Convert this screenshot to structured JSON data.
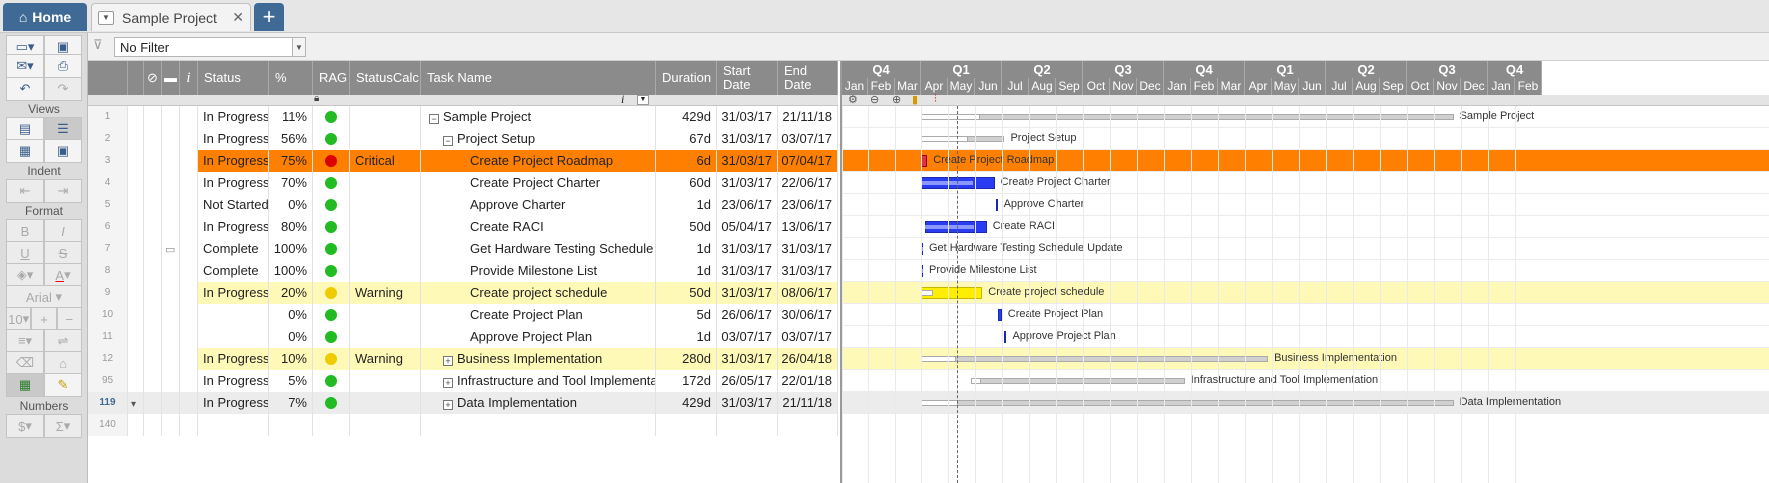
{
  "tabs": {
    "home": "Home",
    "project": "Sample Project",
    "add": "+"
  },
  "sidebar": {
    "views_label": "Views",
    "indent_label": "Indent",
    "format_label": "Format",
    "font_name": "Arial",
    "font_size": "10",
    "numbers_label": "Numbers",
    "currency": "$",
    "sigma": "Σ"
  },
  "filter": {
    "value": "No Filter"
  },
  "columns": {
    "status": "Status",
    "pct": "%",
    "rag": "RAG",
    "statuscalc": "StatusCalc",
    "task": "Task Name",
    "duration": "Duration",
    "start": "Start Date",
    "end": "End Date",
    "info": "i"
  },
  "colors": {
    "orange": "#ff8000",
    "yellow": "#fff9b8",
    "green": "#22bb22",
    "red": "#dd0000",
    "amber": "#eecc00",
    "blue": "#2a3cf0",
    "gantt_yellow": "#ffee00"
  },
  "rows": [
    {
      "num": "1",
      "status": "In Progress",
      "pct": "11%",
      "rag": "green",
      "calc": "",
      "task": "Sample Project",
      "level": 0,
      "exp": "−",
      "dur": "429d",
      "start": "31/03/17",
      "end": "21/11/18",
      "hl": "",
      "label": "Sample Project",
      "note": false
    },
    {
      "num": "2",
      "status": "In Progress",
      "pct": "56%",
      "rag": "green",
      "calc": "",
      "task": "Project Setup",
      "level": 1,
      "exp": "−",
      "dur": "67d",
      "start": "31/03/17",
      "end": "03/07/17",
      "hl": "",
      "label": "Project Setup",
      "note": false
    },
    {
      "num": "3",
      "status": "In Progress",
      "pct": "75%",
      "rag": "red",
      "calc": "Critical",
      "task": "Create Project Roadmap",
      "level": 2,
      "exp": "",
      "dur": "6d",
      "start": "31/03/17",
      "end": "07/04/17",
      "hl": "orange",
      "label": "Create Project Roadmap",
      "note": false
    },
    {
      "num": "4",
      "status": "In Progress",
      "pct": "70%",
      "rag": "green",
      "calc": "",
      "task": "Create Project Charter",
      "level": 2,
      "exp": "",
      "dur": "60d",
      "start": "31/03/17",
      "end": "22/06/17",
      "hl": "",
      "label": "Create Project Charter",
      "note": false
    },
    {
      "num": "5",
      "status": "Not Started",
      "pct": "0%",
      "rag": "green",
      "calc": "",
      "task": "Approve Charter",
      "level": 2,
      "exp": "",
      "dur": "1d",
      "start": "23/06/17",
      "end": "23/06/17",
      "hl": "",
      "label": "Approve Charter",
      "note": false
    },
    {
      "num": "6",
      "status": "In Progress",
      "pct": "80%",
      "rag": "green",
      "calc": "",
      "task": "Create RACI",
      "level": 2,
      "exp": "",
      "dur": "50d",
      "start": "05/04/17",
      "end": "13/06/17",
      "hl": "",
      "label": "Create RACI",
      "note": false
    },
    {
      "num": "7",
      "status": "Complete",
      "pct": "100%",
      "rag": "green",
      "calc": "",
      "task": "Get Hardware Testing Schedule Update",
      "level": 2,
      "exp": "",
      "dur": "1d",
      "start": "31/03/17",
      "end": "31/03/17",
      "hl": "",
      "label": "Get Hardware Testing Schedule Update",
      "note": true
    },
    {
      "num": "8",
      "status": "Complete",
      "pct": "100%",
      "rag": "green",
      "calc": "",
      "task": "Provide Milestone List",
      "level": 2,
      "exp": "",
      "dur": "1d",
      "start": "31/03/17",
      "end": "31/03/17",
      "hl": "",
      "label": "Provide Milestone List",
      "note": false
    },
    {
      "num": "9",
      "status": "In Progress",
      "pct": "20%",
      "rag": "amber",
      "calc": "Warning",
      "task": "Create project schedule",
      "level": 2,
      "exp": "",
      "dur": "50d",
      "start": "31/03/17",
      "end": "08/06/17",
      "hl": "yellow",
      "label": "Create project schedule",
      "note": false
    },
    {
      "num": "10",
      "status": "",
      "pct": "0%",
      "rag": "green",
      "calc": "",
      "task": "Create Project Plan",
      "level": 2,
      "exp": "",
      "dur": "5d",
      "start": "26/06/17",
      "end": "30/06/17",
      "hl": "",
      "label": "Create Project Plan",
      "note": false
    },
    {
      "num": "11",
      "status": "",
      "pct": "0%",
      "rag": "green",
      "calc": "",
      "task": "Approve Project Plan",
      "level": 2,
      "exp": "",
      "dur": "1d",
      "start": "03/07/17",
      "end": "03/07/17",
      "hl": "",
      "label": "Approve Project Plan",
      "note": false
    },
    {
      "num": "12",
      "status": "In Progress",
      "pct": "10%",
      "rag": "amber",
      "calc": "Warning",
      "task": "Business Implementation",
      "level": 1,
      "exp": "+",
      "dur": "280d",
      "start": "31/03/17",
      "end": "26/04/18",
      "hl": "yellow",
      "label": "Business Implementation",
      "note": false
    },
    {
      "num": "95",
      "status": "In Progress",
      "pct": "5%",
      "rag": "green",
      "calc": "",
      "task": "Infrastructure and Tool Implementation",
      "level": 1,
      "exp": "+",
      "dur": "172d",
      "start": "26/05/17",
      "end": "22/01/18",
      "hl": "",
      "label": "Infrastructure and Tool Implementation",
      "note": false
    },
    {
      "num": "119",
      "status": "In Progress",
      "pct": "7%",
      "rag": "green",
      "calc": "",
      "task": "Data Implementation",
      "level": 1,
      "exp": "+",
      "dur": "429d",
      "start": "31/03/17",
      "end": "21/11/18",
      "hl": "grey",
      "label": "Data Implementation",
      "note": false
    },
    {
      "num": "140",
      "status": "",
      "pct": "",
      "rag": "",
      "calc": "",
      "task": "",
      "level": 0,
      "exp": "",
      "dur": "",
      "start": "",
      "end": "",
      "hl": "",
      "label": "",
      "note": false
    }
  ],
  "gantt": {
    "quarters": [
      "Q4",
      "Q1",
      "Q2",
      "Q3",
      "Q4",
      "Q1",
      "Q2",
      "Q3",
      "Q4"
    ],
    "months": [
      "Jan",
      "Feb",
      "Mar",
      "Apr",
      "May",
      "Jun",
      "Jul",
      "Aug",
      "Sep",
      "Oct",
      "Nov",
      "Dec",
      "Jan",
      "Feb",
      "Mar",
      "Apr",
      "May",
      "Jun",
      "Jul",
      "Aug",
      "Sep",
      "Oct",
      "Nov",
      "Dec",
      "Jan",
      "Feb"
    ],
    "tasks": [
      {
        "start": "2017-03-31",
        "end": "2018-11-21",
        "pct": 0.11
      },
      {
        "start": "2017-03-31",
        "end": "2017-07-03",
        "pct": 0.56
      },
      {
        "start": "2017-03-31",
        "end": "2017-04-07",
        "pct": 0.75
      },
      {
        "start": "2017-03-31",
        "end": "2017-06-22",
        "pct": 0.7
      },
      {
        "start": "2017-06-23",
        "end": "2017-06-23",
        "pct": 0
      },
      {
        "start": "2017-04-05",
        "end": "2017-06-13",
        "pct": 0.8
      },
      {
        "start": "2017-03-31",
        "end": "2017-03-31",
        "pct": 1
      },
      {
        "start": "2017-03-31",
        "end": "2017-03-31",
        "pct": 1
      },
      {
        "start": "2017-03-31",
        "end": "2017-06-08",
        "pct": 0.2
      },
      {
        "start": "2017-06-26",
        "end": "2017-06-30",
        "pct": 0
      },
      {
        "start": "2017-07-03",
        "end": "2017-07-03",
        "pct": 0
      },
      {
        "start": "2017-03-31",
        "end": "2018-04-26",
        "pct": 0.1
      },
      {
        "start": "2017-05-26",
        "end": "2018-01-22",
        "pct": 0.05
      },
      {
        "start": "2017-03-31",
        "end": "2018-11-21",
        "pct": 0.07
      }
    ]
  }
}
